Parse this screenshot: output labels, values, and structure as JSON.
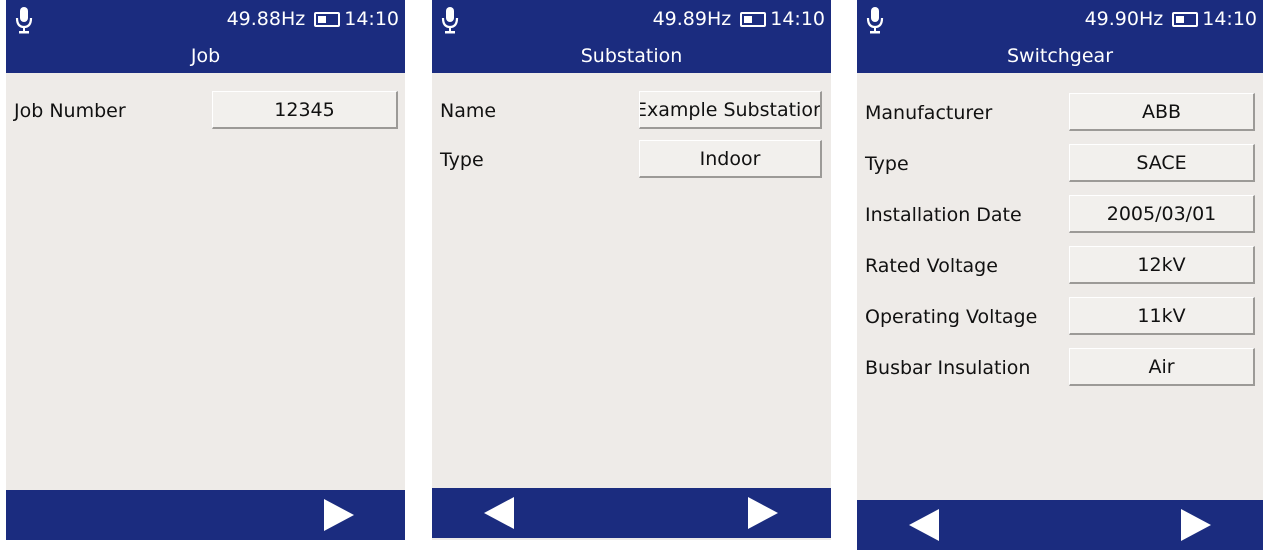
{
  "colors": {
    "header_bar": "#1b2c7f",
    "screen_background": "#eeebe8",
    "field_background": "#f2f0ed"
  },
  "icons": {
    "status_left": "microphone-icon",
    "status_battery": "battery-icon",
    "nav_back": "triangle-left-icon",
    "nav_next": "triangle-right-icon"
  },
  "screens": {
    "job": {
      "frequency": "49.88Hz",
      "time": "14:10",
      "title": "Job",
      "fields": [
        {
          "label": "Job Number",
          "value": "12345"
        }
      ]
    },
    "substation": {
      "frequency": "49.89Hz",
      "time": "14:10",
      "title": "Substation",
      "fields": [
        {
          "label": "Name",
          "value": "Example Substation"
        },
        {
          "label": "Type",
          "value": "Indoor"
        }
      ]
    },
    "switchgear": {
      "frequency": "49.90Hz",
      "time": "14:10",
      "title": "Switchgear",
      "fields": [
        {
          "label": "Manufacturer",
          "value": "ABB"
        },
        {
          "label": "Type",
          "value": "SACE"
        },
        {
          "label": "Installation Date",
          "value": "2005/03/01"
        },
        {
          "label": "Rated Voltage",
          "value": "12kV"
        },
        {
          "label": "Operating Voltage",
          "value": "11kV"
        },
        {
          "label": "Busbar Insulation",
          "value": "Air"
        }
      ]
    }
  }
}
